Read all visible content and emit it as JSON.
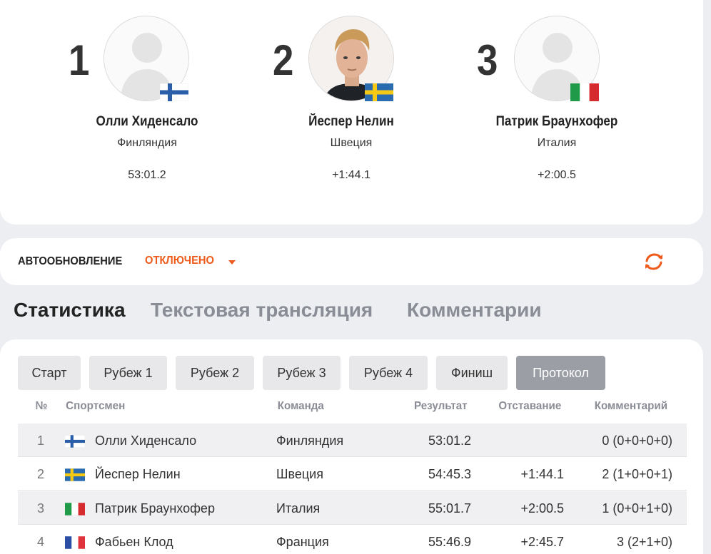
{
  "podium": [
    {
      "rank": "1",
      "name": "Олли Хиденсало",
      "country": "Финляндия",
      "result": "53:01.2",
      "flag": "finland",
      "photo": "placeholder"
    },
    {
      "rank": "2",
      "name": "Йеспер Нелин",
      "country": "Швеция",
      "result": "+1:44.1",
      "flag": "sweden",
      "photo": "athlete-photo"
    },
    {
      "rank": "3",
      "name": "Патрик Браунхофер",
      "country": "Италия",
      "result": "+2:00.5",
      "flag": "italy",
      "photo": "placeholder"
    }
  ],
  "autoupdate": {
    "label": "АВТООБНОВЛЕНИЕ",
    "state": "ОТКЛЮЧЕНО",
    "icon": "refresh-icon"
  },
  "tabs": [
    {
      "label": "Статистика",
      "active": true
    },
    {
      "label": "Текстовая трансляция",
      "active": false
    },
    {
      "label": "Комментарии",
      "active": false
    }
  ],
  "segments": [
    {
      "label": "Старт",
      "active": false
    },
    {
      "label": "Рубеж 1",
      "active": false
    },
    {
      "label": "Рубеж 2",
      "active": false
    },
    {
      "label": "Рубеж 3",
      "active": false
    },
    {
      "label": "Рубеж 4",
      "active": false
    },
    {
      "label": "Финиш",
      "active": false
    },
    {
      "label": "Протокол",
      "active": true
    }
  ],
  "table": {
    "headers": {
      "num": "№",
      "athlete": "Спортсмен",
      "team": "Команда",
      "result": "Результат",
      "gap": "Отставание",
      "comment": "Комментарий"
    },
    "rows": [
      {
        "num": "1",
        "flag": "finland",
        "athlete": "Олли Хиденсало",
        "team": "Финляндия",
        "result": "53:01.2",
        "gap": "",
        "comment": "0 (0+0+0+0)"
      },
      {
        "num": "2",
        "flag": "sweden",
        "athlete": "Йеспер Нелин",
        "team": "Швеция",
        "result": "54:45.3",
        "gap": "+1:44.1",
        "comment": "2 (1+0+0+1)"
      },
      {
        "num": "3",
        "flag": "italy",
        "athlete": "Патрик Браунхофер",
        "team": "Италия",
        "result": "55:01.7",
        "gap": "+2:00.5",
        "comment": "1 (0+0+1+0)"
      },
      {
        "num": "4",
        "flag": "france",
        "athlete": "Фабьен Клод",
        "team": "Франция",
        "result": "55:46.9",
        "gap": "+2:45.7",
        "comment": "3 (2+1+0)"
      }
    ]
  },
  "colors": {
    "accent": "#ee5a1a",
    "text": "#222222",
    "muted": "#8a8d96",
    "activeButton": "#9b9ea5"
  }
}
